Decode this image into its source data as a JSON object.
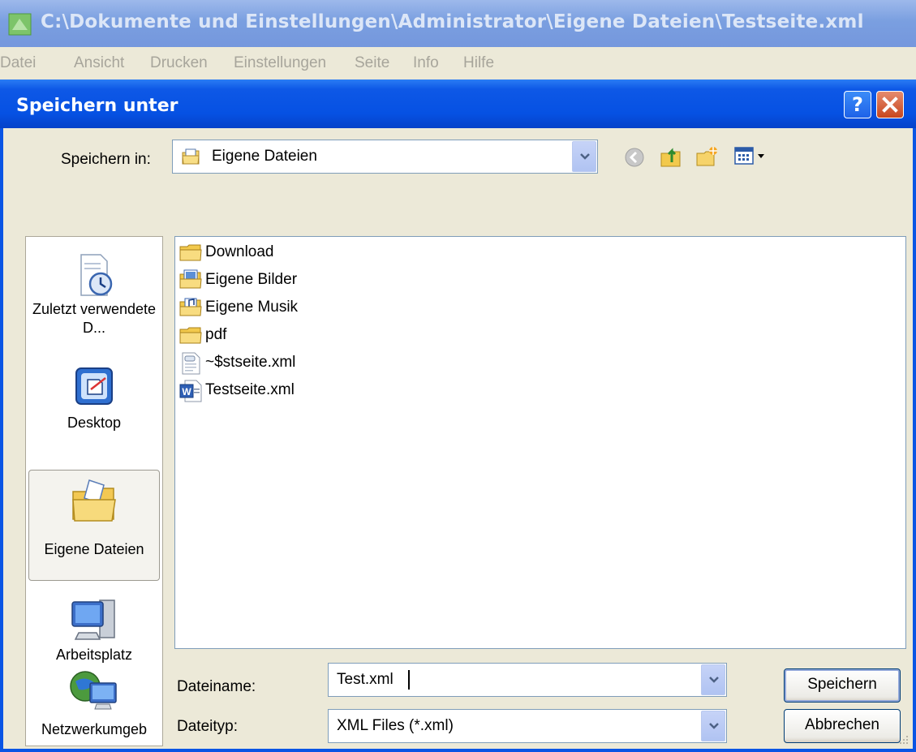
{
  "app": {
    "title": "C:\\Dokumente und Einstellungen\\Administrator\\Eigene Dateien\\Testseite.xml",
    "menu": [
      "Datei",
      "Ansicht",
      "Drucken",
      "Einstellungen",
      "Seite",
      "Info",
      "Hilfe"
    ]
  },
  "dialog": {
    "title": "Speichern unter",
    "save_in_label": "Speichern in:",
    "save_in_value": "Eigene Dateien",
    "places": [
      {
        "label": "Zuletzt verwendete D...",
        "icon": "recent-documents-icon"
      },
      {
        "label": "Desktop",
        "icon": "desktop-icon"
      },
      {
        "label": "Eigene Dateien",
        "icon": "my-documents-icon",
        "selected": true
      },
      {
        "label": "Arbeitsplatz",
        "icon": "my-computer-icon"
      },
      {
        "label": "Netzwerkumgeb",
        "icon": "network-icon"
      }
    ],
    "files": [
      {
        "name": "Download",
        "icon": "folder-icon"
      },
      {
        "name": "Eigene Bilder",
        "icon": "pictures-folder-icon"
      },
      {
        "name": "Eigene Musik",
        "icon": "music-folder-icon"
      },
      {
        "name": "pdf",
        "icon": "folder-icon"
      },
      {
        "name": "~$stseite.xml",
        "icon": "xml-file-icon"
      },
      {
        "name": "Testseite.xml",
        "icon": "word-xml-file-icon"
      }
    ],
    "filename_label": "Dateiname:",
    "filename_value": "Test.xml",
    "filetype_label": "Dateityp:",
    "filetype_value": "XML Files (*.xml)",
    "save_button": "Speichern",
    "cancel_button": "Abbrechen",
    "help_button": "?"
  },
  "colors": {
    "title_active": "#0A55E4",
    "title_inactive": "#7A9FE0",
    "dialog_bg": "#ECE9D8",
    "close_red": "#C8461E"
  }
}
